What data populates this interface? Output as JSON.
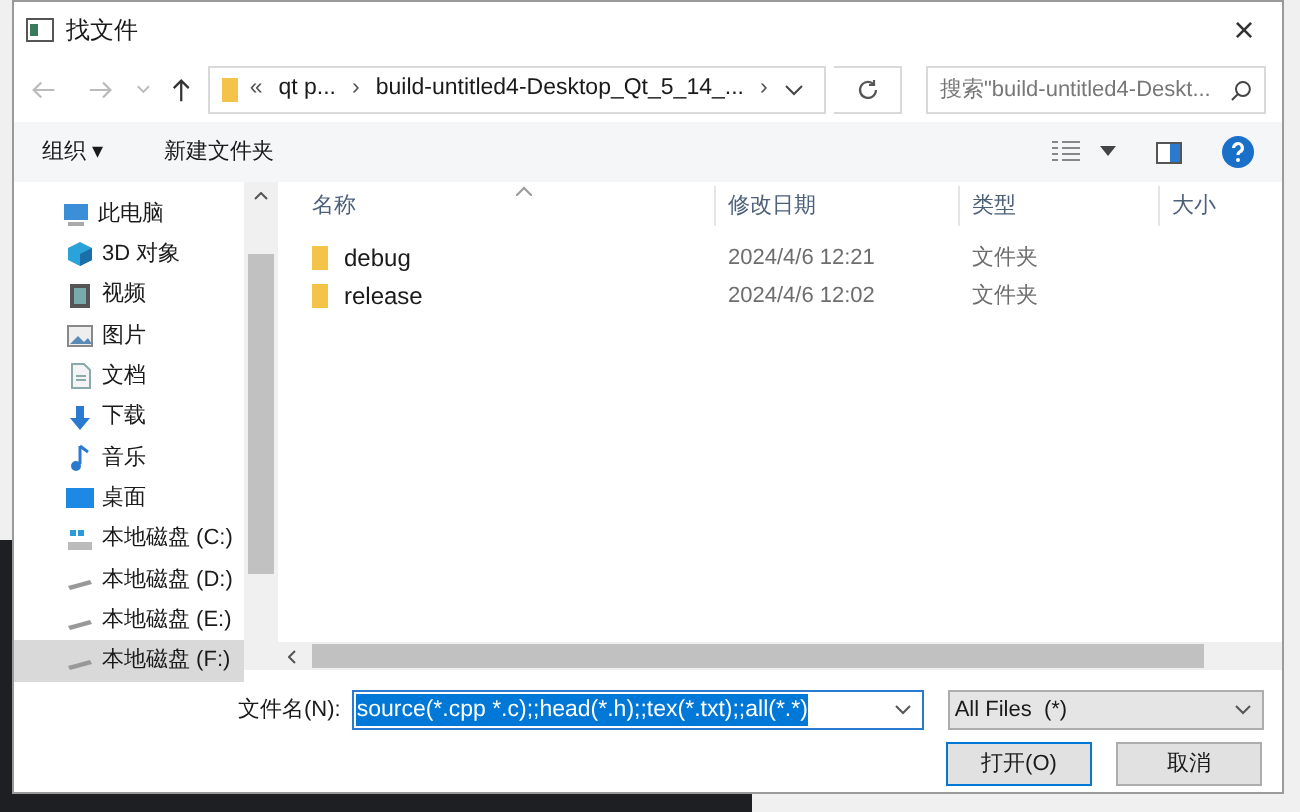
{
  "window": {
    "title": "找文件",
    "close": "×"
  },
  "address": {
    "segments": [
      "«",
      "qt p...",
      "›",
      "build-untitled4-Desktop_Qt_5_14_...",
      "›"
    ]
  },
  "search": {
    "placeholder": "搜索\"build-untitled4-Deskt..."
  },
  "toolbar": {
    "organize": "组织 ▾",
    "new_folder": "新建文件夹"
  },
  "sidebar": {
    "items": [
      {
        "label": "此电脑",
        "kind": "pc",
        "selected": false,
        "children": [
          {
            "label": "3D 对象",
            "kind": "cube",
            "selected": false
          },
          {
            "label": "视频",
            "kind": "video",
            "selected": false
          },
          {
            "label": "图片",
            "kind": "image",
            "selected": false
          },
          {
            "label": "文档",
            "kind": "doc",
            "selected": false
          },
          {
            "label": "下载",
            "kind": "download",
            "selected": false
          },
          {
            "label": "音乐",
            "kind": "music",
            "selected": false
          },
          {
            "label": "桌面",
            "kind": "desktop",
            "selected": false
          },
          {
            "label": "本地磁盘 (C:)",
            "kind": "sysdrive",
            "selected": false
          },
          {
            "label": "本地磁盘 (D:)",
            "kind": "drive",
            "selected": false
          },
          {
            "label": "本地磁盘 (E:)",
            "kind": "drive",
            "selected": false
          },
          {
            "label": "本地磁盘 (F:)",
            "kind": "drive",
            "selected": true
          }
        ]
      }
    ]
  },
  "table": {
    "columns": [
      "名称",
      "修改日期",
      "类型",
      "大小"
    ],
    "rows": [
      {
        "name": "debug",
        "modified": "2024/4/6 12:21",
        "type": "文件夹"
      },
      {
        "name": "release",
        "modified": "2024/4/6 12:02",
        "type": "文件夹"
      }
    ]
  },
  "filename": {
    "label": "文件名(N):",
    "value": "source(*.cpp *.c);;head(*.h);;tex(*.txt);;all(*.*)"
  },
  "filter": {
    "value": "All Files  (*)"
  },
  "buttons": [
    {
      "label": "打开(O)",
      "kind": "primary"
    },
    {
      "label": "取消",
      "kind": "normal"
    }
  ]
}
